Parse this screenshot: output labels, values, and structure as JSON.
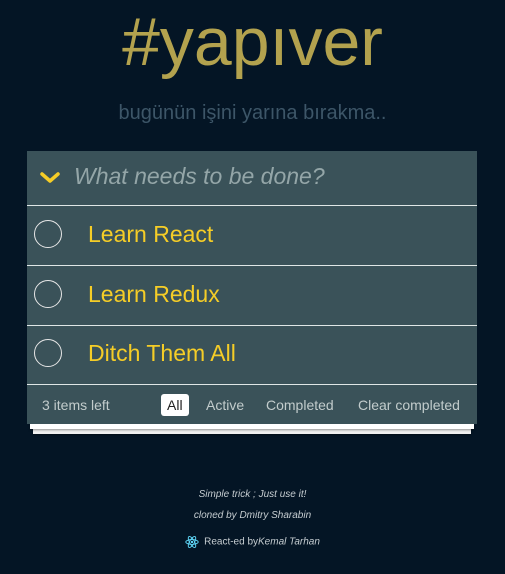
{
  "header": {
    "title": "#yapıver",
    "subtitle": "bugünün işini yarına bırakma.."
  },
  "new_todo": {
    "placeholder": "What needs to be done?",
    "value": ""
  },
  "todos": [
    {
      "text": "Learn React",
      "completed": false
    },
    {
      "text": "Learn Redux",
      "completed": false
    },
    {
      "text": "Ditch Them All",
      "completed": false
    }
  ],
  "footer": {
    "count_text": "3 items left",
    "filters": [
      "All",
      "Active",
      "Completed"
    ],
    "selected_filter": "All",
    "clear_label": "Clear completed"
  },
  "info": {
    "line1": "Simple trick ; Just use it!",
    "line2": "cloned by Dmitry Sharabin",
    "react_prefix": "React-ed by",
    "author": "Kemal Tarhan"
  },
  "colors": {
    "background": "#041525",
    "title": "#b3a24e",
    "todo_text": "#f5cd27",
    "panel": "#3a5259",
    "react_logo": "#61dafb"
  },
  "icons": {
    "toggle_all": "chevron-down-icon",
    "react": "react-logo-icon"
  }
}
